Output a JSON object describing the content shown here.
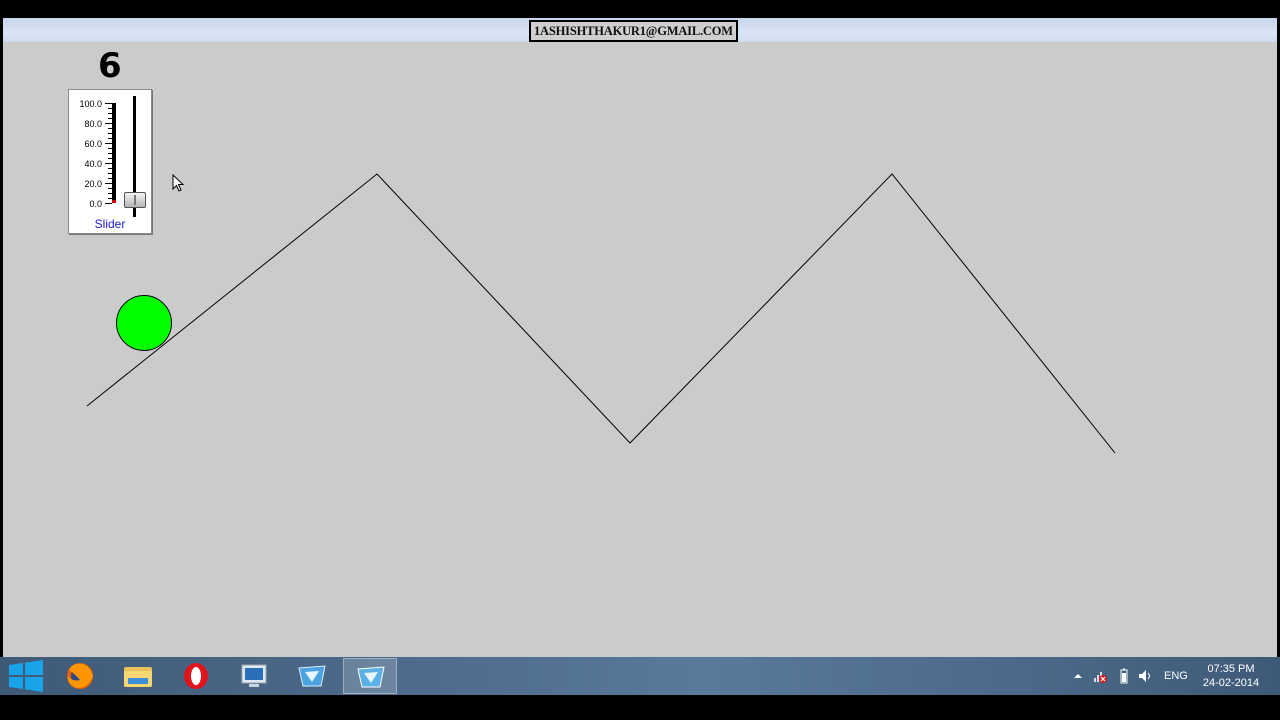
{
  "window": {
    "title": "1ASHISHTHAKUR1@GMAIL.COM",
    "background": "#cbcbcb"
  },
  "counter": {
    "value": "6"
  },
  "slider": {
    "caption": "Slider",
    "ticks": [
      "100.0",
      "80.0",
      "60.0",
      "40.0",
      "20.0",
      "0.0"
    ],
    "value": 0,
    "range": [
      0,
      100
    ],
    "fill_color": "#d40000"
  },
  "ball": {
    "color": "#00ff00"
  },
  "taskbar": {
    "apps": [
      {
        "name": "start-button",
        "icon": "windows-logo-icon"
      },
      {
        "name": "firefox",
        "icon": "firefox-icon"
      },
      {
        "name": "file-explorer",
        "icon": "folder-icon"
      },
      {
        "name": "opera",
        "icon": "opera-icon"
      },
      {
        "name": "computer",
        "icon": "monitor-icon"
      },
      {
        "name": "app-1",
        "icon": "app-icon"
      },
      {
        "name": "app-2",
        "icon": "app-icon"
      }
    ],
    "tray": {
      "language": "ENG",
      "time": "07:35 PM",
      "date": "24-02-2014"
    }
  }
}
